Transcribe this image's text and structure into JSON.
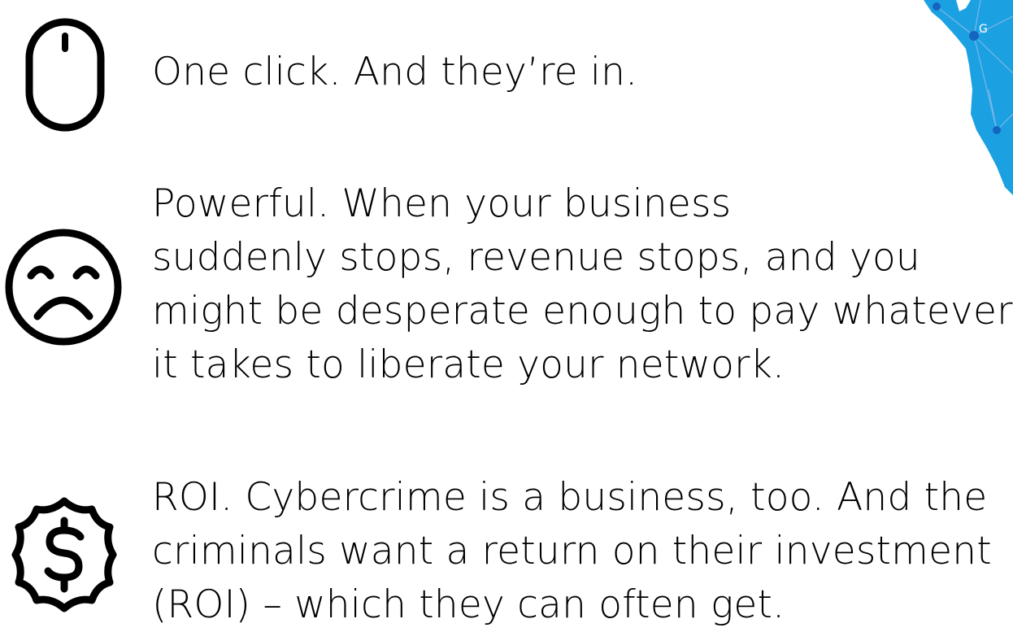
{
  "colors": {
    "text": "#000000",
    "icon": "#000000",
    "map_fill": "#1ba1e2",
    "map_node": "#1565c0"
  },
  "items": [
    {
      "icon": "mouse-icon",
      "lines": [
        "One click. And they’re in."
      ]
    },
    {
      "icon": "sad-face-icon",
      "lines": [
        "Powerful. When your business",
        "suddenly stops, revenue stops, and you",
        "might be desperate enough to pay whatever",
        "it takes to liberate your network."
      ]
    },
    {
      "icon": "dollar-badge-icon",
      "lines": [
        "ROI. Cybercrime is a business, too. And the",
        "criminals want a return on their investment",
        "(ROI) – which they can often get."
      ]
    }
  ],
  "decoration": {
    "icon": "world-map-network-icon"
  }
}
